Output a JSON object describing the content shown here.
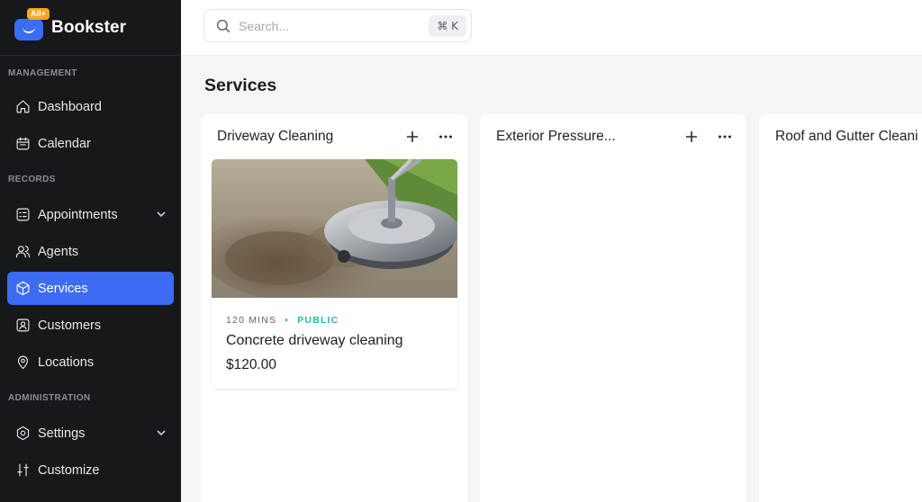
{
  "brand": {
    "name": "Bookster",
    "badge": "All+"
  },
  "sidebar": {
    "sections": [
      {
        "label": "MANAGEMENT"
      },
      {
        "label": "RECORDS"
      },
      {
        "label": "ADMINISTRATION"
      }
    ],
    "items": [
      {
        "label": "Dashboard",
        "icon": "home-icon"
      },
      {
        "label": "Calendar",
        "icon": "calendar-icon"
      },
      {
        "label": "Appointments",
        "icon": "appointments-icon",
        "expandable": true
      },
      {
        "label": "Agents",
        "icon": "users-icon"
      },
      {
        "label": "Services",
        "icon": "cube-icon",
        "active": true
      },
      {
        "label": "Customers",
        "icon": "contact-icon"
      },
      {
        "label": "Locations",
        "icon": "pin-icon"
      },
      {
        "label": "Settings",
        "icon": "gear-icon",
        "expandable": true
      },
      {
        "label": "Customize",
        "icon": "sliders-icon"
      }
    ]
  },
  "search": {
    "placeholder": "Search...",
    "shortcut": "⌘ K"
  },
  "page": {
    "title": "Services"
  },
  "columns": [
    {
      "title": "Driveway Cleaning",
      "services": [
        {
          "duration": "120 MINS",
          "visibility": "PUBLIC",
          "name": "Concrete driveway cleaning",
          "price": "$120.00"
        }
      ]
    },
    {
      "title": "Exterior Pressure...",
      "services": []
    },
    {
      "title": "Roof and Gutter Cleani",
      "services": []
    }
  ],
  "colors": {
    "accent": "#3d6cf2",
    "sidebar_bg": "#17181c",
    "public_badge": "#27b7a1"
  }
}
